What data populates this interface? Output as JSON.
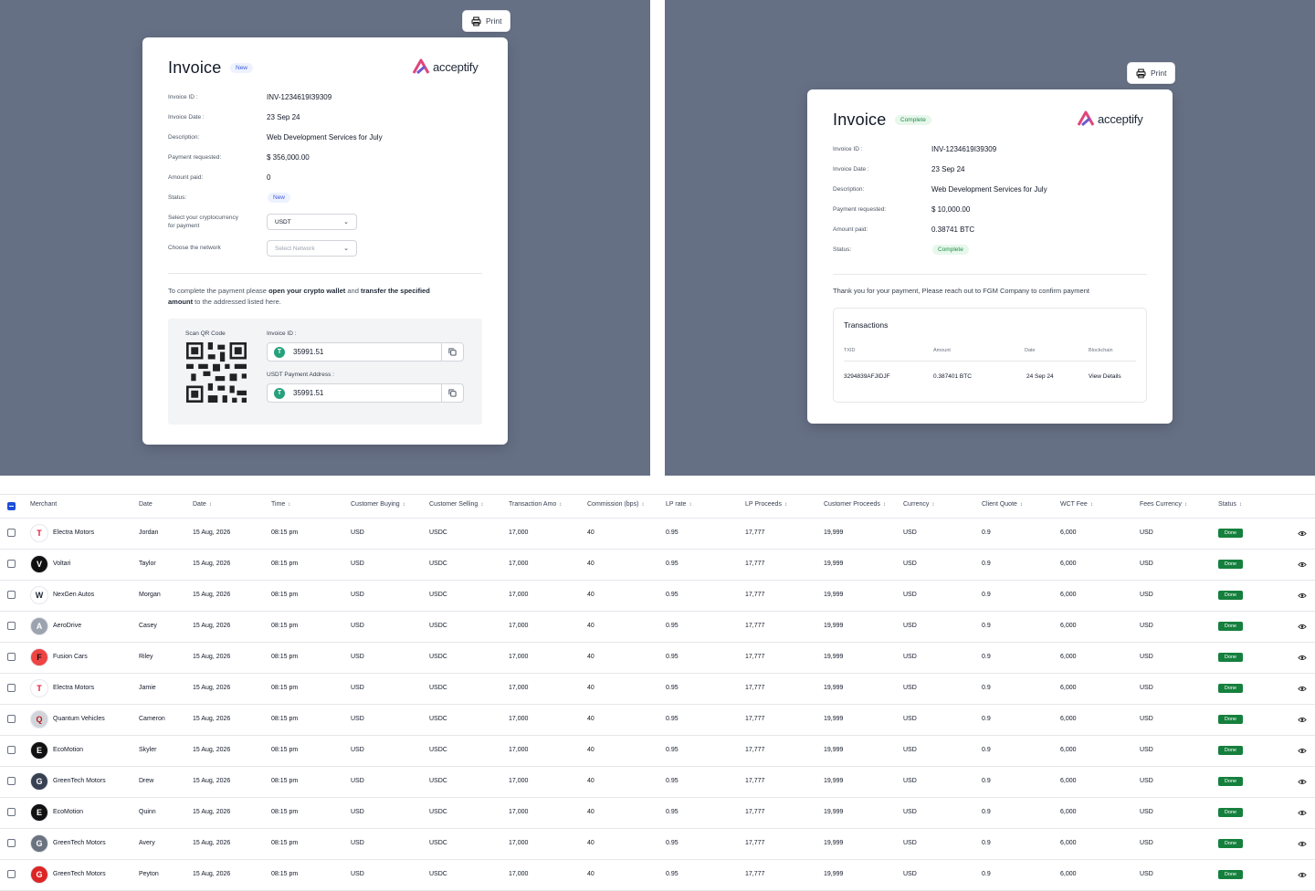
{
  "print_label": "Print",
  "logo_text": "acceptify",
  "invoice_new": {
    "title": "Invoice",
    "badge": "New",
    "fields": [
      {
        "label": "Invoice ID :",
        "value": "INV-1234619I39309"
      },
      {
        "label": "Invoice Date :",
        "value": "23 Sep 24"
      },
      {
        "label": "Description:",
        "value": "Web Development Services for July"
      },
      {
        "label": "Payment requested:",
        "value": "$ 356,000.00"
      },
      {
        "label": "Amount paid:",
        "value": "0"
      }
    ],
    "status_label": "Status:",
    "status_value": "New",
    "crypto_label_1": "Select your cryptocurrency",
    "crypto_label_2": "for payment",
    "crypto_value": "USDT",
    "network_label": "Choose the network",
    "network_placeholder": "Select Network",
    "instruction_1": "To complete the payment please ",
    "instruction_b1": "open your crypto wallet",
    "instruction_2": " and ",
    "instruction_b2": "transfer the specified",
    "instruction_b3": "amount",
    "instruction_3": " to the addressed listed here.",
    "qr_label": "Scan QR Code",
    "invoice_id_label": "Invoice ID :",
    "invoice_id_value": "35991.51",
    "address_label": "USDT Payment Address :",
    "address_value": "35991.51"
  },
  "invoice_complete": {
    "title": "Invoice",
    "badge": "Complete",
    "fields": [
      {
        "label": "Invoice ID :",
        "value": "INV-1234619I39309"
      },
      {
        "label": "Invoice Date :",
        "value": "23 Sep 24"
      },
      {
        "label": "Description:",
        "value": "Web Development Services for July"
      },
      {
        "label": "Payment requested:",
        "value": "$ 10,000.00"
      },
      {
        "label": "Amount paid:",
        "value": "0.38741 BTC"
      }
    ],
    "status_label": "Status:",
    "status_value": "Complete",
    "thanks": "Thank you for your payment, Please reach out to FGM Company to confirm payment",
    "transactions_title": "Transactions",
    "tx_headers": [
      "TXID",
      "Amount",
      "Date",
      "Blockchain"
    ],
    "tx_row": [
      "3294839AFJIDJF",
      "0.387401 BTC",
      "24 Sep 24",
      "View Details"
    ]
  },
  "table": {
    "headers": [
      "Merchant",
      "Date",
      "Date",
      "Time",
      "Customer Buying",
      "Customer Selling",
      "Transaction Amo",
      "Commission (bps)",
      "LP rate",
      "LP Proceeds",
      "Customer Proceeds",
      "Currency",
      "Client Quote",
      "WCT Fee",
      "Fees Currency",
      "Status"
    ],
    "rows": [
      {
        "merchant": "Electra Motors",
        "name": "Jordan",
        "avatar": "T",
        "color": "#ffffff",
        "fg": "#e31937"
      },
      {
        "merchant": "Voltari",
        "name": "Taylor",
        "avatar": "V",
        "color": "#111111",
        "fg": "#ffffff"
      },
      {
        "merchant": "NexGen Autos",
        "name": "Morgan",
        "avatar": "W",
        "color": "#ffffff",
        "fg": "#1f2937"
      },
      {
        "merchant": "AeroDrive",
        "name": "Casey",
        "avatar": "A",
        "color": "#9ca3af",
        "fg": "#ffffff"
      },
      {
        "merchant": "Fusion Cars",
        "name": "Riley",
        "avatar": "F",
        "color": "#ef4444",
        "fg": "#111111"
      },
      {
        "merchant": "Electra Motors",
        "name": "Jamie",
        "avatar": "T",
        "color": "#ffffff",
        "fg": "#e31937"
      },
      {
        "merchant": "Quantum Vehicles",
        "name": "Cameron",
        "avatar": "Q",
        "color": "#d1d5db",
        "fg": "#b91c1c"
      },
      {
        "merchant": "EcoMotion",
        "name": "Skyler",
        "avatar": "E",
        "color": "#111111",
        "fg": "#ffffff"
      },
      {
        "merchant": "GreenTech Motors",
        "name": "Drew",
        "avatar": "G",
        "color": "#374151",
        "fg": "#ffffff"
      },
      {
        "merchant": "EcoMotion",
        "name": "Quinn",
        "avatar": "E",
        "color": "#111111",
        "fg": "#ffffff"
      },
      {
        "merchant": "GreenTech Motors",
        "name": "Avery",
        "avatar": "G",
        "color": "#6b7280",
        "fg": "#ffffff"
      },
      {
        "merchant": "GreenTech Motors",
        "name": "Peyton",
        "avatar": "G",
        "color": "#dc2626",
        "fg": "#ffffff"
      }
    ],
    "cells": {
      "date": "15 Aug, 2026",
      "time": "08:15 pm",
      "buying": "USD",
      "selling": "USDC",
      "amount": "17,000",
      "commission": "40",
      "lp_rate": "0.95",
      "lp_proceeds": "17,777",
      "customer_proceeds": "19,999",
      "currency": "USD",
      "client_quote": "0.9",
      "wct_fee": "6,000",
      "fees_currency": "USD",
      "status": "Done"
    }
  }
}
